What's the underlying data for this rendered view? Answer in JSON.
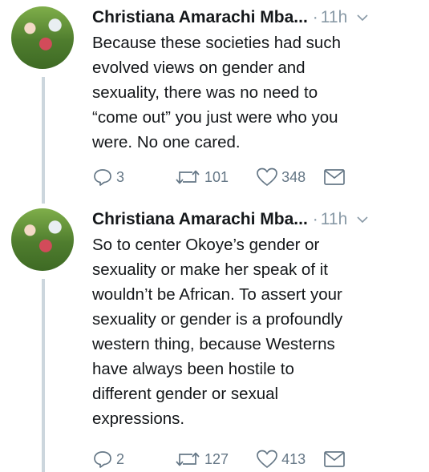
{
  "tweets": [
    {
      "author": "Christiana Amarachi Mba...",
      "separator": "·",
      "time": "11h",
      "text": "Because these societies had such\nevolved views on gender and\nsexuality, there was no need to\n“come out” you just were who you\nwere. No one cared.",
      "replies": "3",
      "retweets": "101",
      "likes": "348"
    },
    {
      "author": "Christiana Amarachi Mba...",
      "separator": "·",
      "time": "11h",
      "text": "So to center Okoye’s gender or\nsexuality or make her speak of it\nwouldn’t be African. To assert your\nsexuality or gender is a profoundly\nwestern thing, because Westerns\nhave always been hostile to\ndifferent gender or sexual\nexpressions.",
      "replies": "2",
      "retweets": "127",
      "likes": "413"
    }
  ],
  "icons": {
    "reply": "reply-icon",
    "retweet": "retweet-icon",
    "like": "heart-icon",
    "dm": "envelope-icon",
    "caret": "chevron-down-icon"
  },
  "colors": {
    "text": "#14171a",
    "muted": "#8899a6",
    "icon": "#657786",
    "thread_line": "#ccd6dd"
  }
}
